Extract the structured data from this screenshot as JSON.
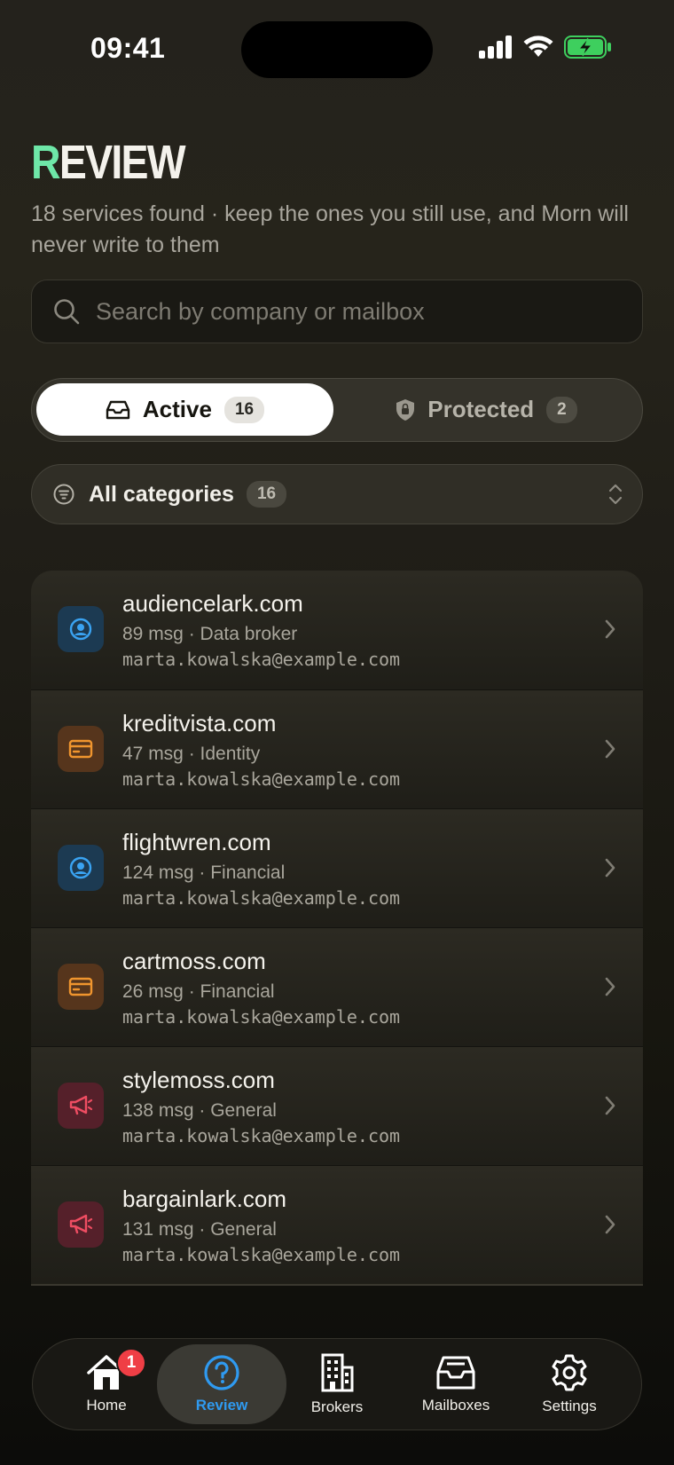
{
  "status_bar": {
    "time": "09:41"
  },
  "header": {
    "title_accent": "R",
    "title_rest": "EVIEW",
    "subtitle": "18 services found · keep the ones you still use, and Morn will never write to them"
  },
  "search": {
    "placeholder": "Search by company or mailbox",
    "value": ""
  },
  "segments": {
    "active": {
      "label": "Active",
      "count": "16"
    },
    "protected": {
      "label": "Protected",
      "count": "2"
    }
  },
  "filter": {
    "label": "All categories",
    "count": "16"
  },
  "services": [
    {
      "domain": "audiencelark.com",
      "meta": "89 msg · Data broker",
      "email": "marta.kowalska@example.com",
      "icon": "person-circle-icon",
      "color": "blue"
    },
    {
      "domain": "kreditvista.com",
      "meta": "47 msg · Identity",
      "email": "marta.kowalska@example.com",
      "icon": "credit-card-icon",
      "color": "orange"
    },
    {
      "domain": "flightwren.com",
      "meta": "124 msg · Financial",
      "email": "marta.kowalska@example.com",
      "icon": "person-circle-icon",
      "color": "blue"
    },
    {
      "domain": "cartmoss.com",
      "meta": "26 msg · Financial",
      "email": "marta.kowalska@example.com",
      "icon": "credit-card-icon",
      "color": "orange"
    },
    {
      "domain": "stylemoss.com",
      "meta": "138 msg · General",
      "email": "marta.kowalska@example.com",
      "icon": "megaphone-icon",
      "color": "red"
    },
    {
      "domain": "bargainlark.com",
      "meta": "131 msg · General",
      "email": "marta.kowalska@example.com",
      "icon": "megaphone-icon",
      "color": "red"
    }
  ],
  "tabbar": {
    "home": {
      "label": "Home",
      "badge": "1"
    },
    "review": {
      "label": "Review"
    },
    "brokers": {
      "label": "Brokers"
    },
    "mailboxes": {
      "label": "Mailboxes"
    },
    "settings": {
      "label": "Settings"
    }
  },
  "colors": {
    "accent_green": "#6ee7a8",
    "review_blue": "#2f9af0",
    "badge_red": "#ef3e45",
    "battery_green": "#3ecf5e"
  }
}
